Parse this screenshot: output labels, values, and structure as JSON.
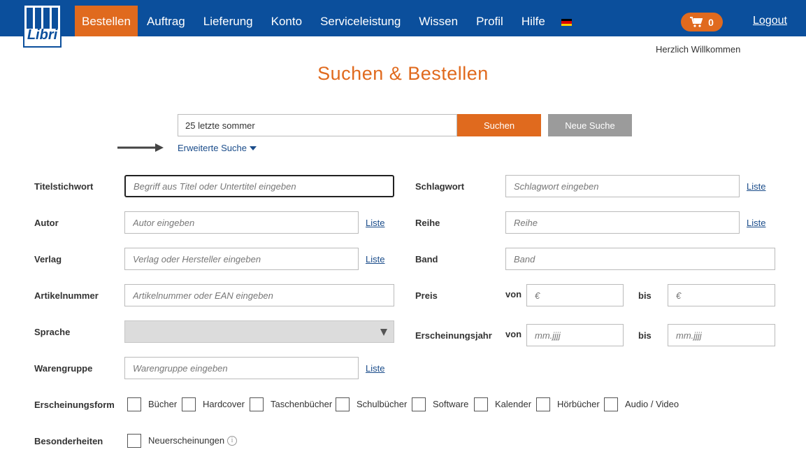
{
  "logo": {
    "text": "Libri"
  },
  "nav": {
    "items": [
      "Bestellen",
      "Auftrag",
      "Lieferung",
      "Konto",
      "Serviceleistung",
      "Wissen",
      "Profil",
      "Hilfe"
    ],
    "active": "Bestellen",
    "flag_colors": [
      "#000000",
      "#dd0000",
      "#ffce00"
    ],
    "cart_count": "0",
    "logout": "Logout"
  },
  "welcome": "Herzlich Willkommen",
  "page_title": "Suchen & Bestellen",
  "search": {
    "value": "25 letzte sommer",
    "submit": "Suchen",
    "reset": "Neue Suche",
    "advanced": "Erweiterte Suche"
  },
  "form": {
    "titelstichwort": {
      "label": "Titelstichwort",
      "placeholder": "Begriff aus Titel oder Untertitel eingeben"
    },
    "autor": {
      "label": "Autor",
      "placeholder": "Autor eingeben",
      "link": "Liste"
    },
    "verlag": {
      "label": "Verlag",
      "placeholder": "Verlag oder Hersteller eingeben",
      "link": "Liste"
    },
    "artikelnummer": {
      "label": "Artikelnummer",
      "placeholder": "Artikelnummer oder EAN eingeben"
    },
    "sprache": {
      "label": "Sprache",
      "value": ""
    },
    "warengruppe": {
      "label": "Warengruppe",
      "placeholder": "Warengruppe eingeben",
      "link": "Liste"
    },
    "schlagwort": {
      "label": "Schlagwort",
      "placeholder": "Schlagwort eingeben",
      "link": "Liste"
    },
    "reihe": {
      "label": "Reihe",
      "placeholder": "Reihe",
      "link": "Liste"
    },
    "band": {
      "label": "Band",
      "placeholder": "Band"
    },
    "preis": {
      "label": "Preis",
      "von": "von",
      "bis": "bis",
      "von_placeholder": "€",
      "bis_placeholder": "€"
    },
    "erscheinungsjahr": {
      "label": "Erscheinungsjahr",
      "von": "von",
      "bis": "bis",
      "von_placeholder": "mm.jjjj",
      "bis_placeholder": "mm.jjjj"
    },
    "erscheinungsform": {
      "label": "Erscheinungsform",
      "options": [
        "Bücher",
        "Hardcover",
        "Taschenbücher",
        "Schulbücher",
        "Software",
        "Kalender",
        "Hörbücher",
        "Audio / Video"
      ]
    },
    "besonderheiten": {
      "label": "Besonderheiten",
      "options": [
        "Neuerscheinungen"
      ]
    }
  },
  "colors": {
    "primary": "#0b4f9c",
    "accent": "#e06a1e",
    "link": "#1a4c8a"
  }
}
